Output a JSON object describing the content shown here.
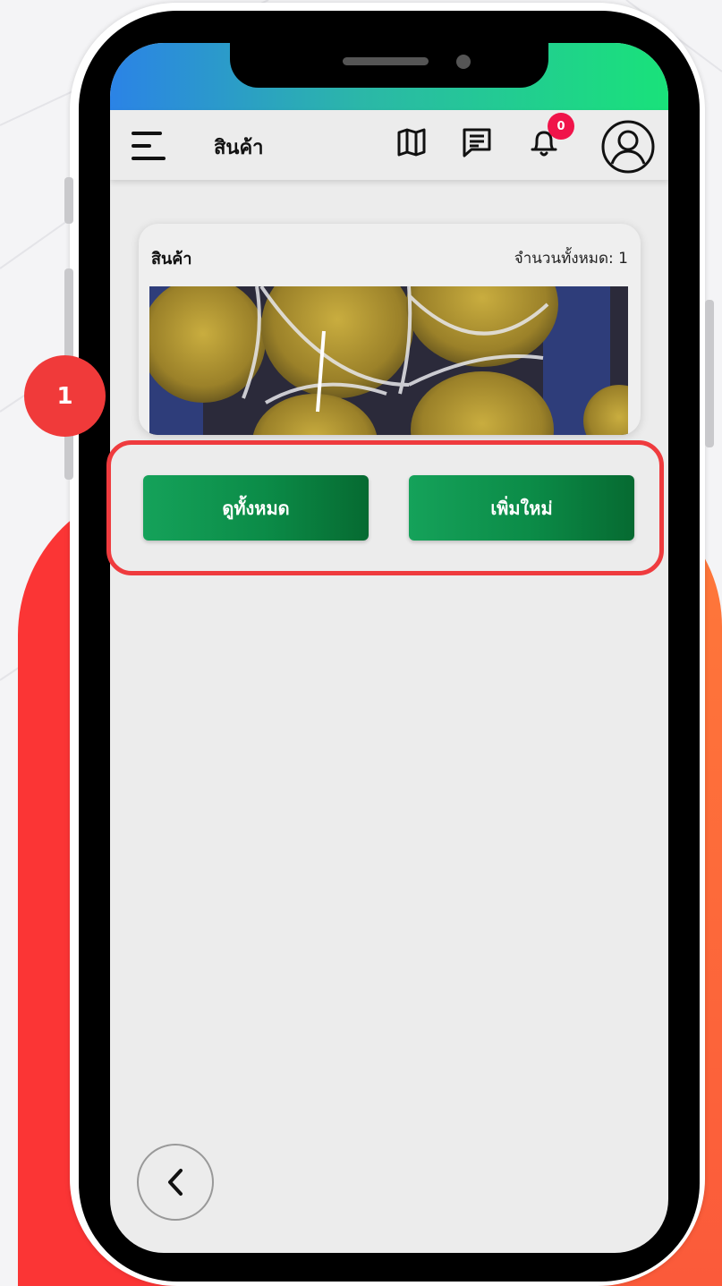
{
  "app_bar": {
    "title": "สินค้า",
    "icons": [
      "menu-icon",
      "map-icon",
      "chat-icon",
      "bell-icon",
      "user-icon"
    ],
    "notification_count": "0"
  },
  "product_card": {
    "title": "สินค้า",
    "count_label": "จำนวนทั้งหมด: 1",
    "image": "melon-photo"
  },
  "actions": {
    "view_all_label": "ดูทั้งหมด",
    "add_new_label": "เพิ่มใหม่"
  },
  "navigation": {
    "back_icon": "chevron-left-icon"
  },
  "annotation": {
    "step_number": "1"
  },
  "colors": {
    "primary_button": "#0b8b47",
    "highlight": "#ef3b3e",
    "badge": "#f0144a",
    "status_gradient_start": "#2b83e6",
    "status_gradient_end": "#19e27a"
  }
}
